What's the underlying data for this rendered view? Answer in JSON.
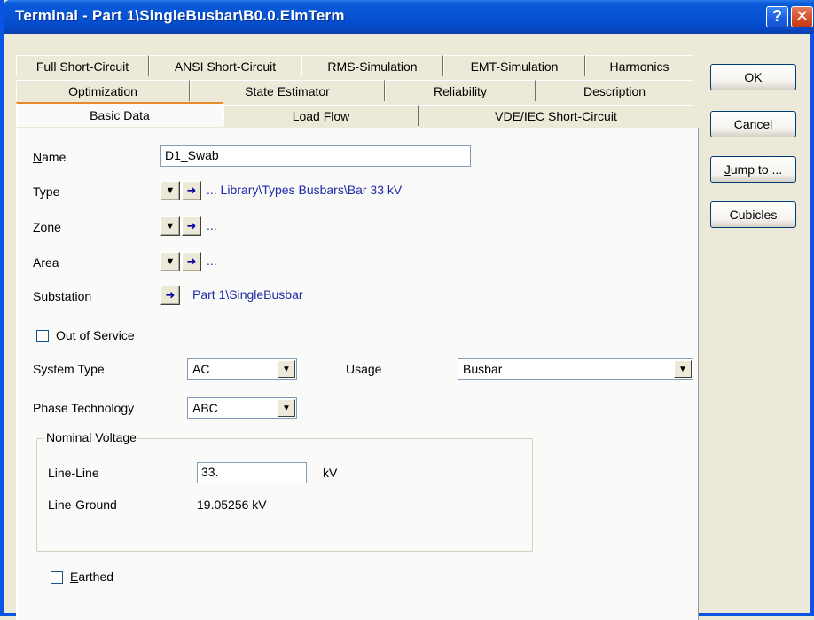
{
  "window": {
    "title": "Terminal - Part 1\\SingleBusbar\\B0.0.ElmTerm"
  },
  "titlebar": {
    "help_glyph": "?",
    "close_glyph": "✕"
  },
  "tabs": {
    "row1": [
      "Full Short-Circuit",
      "ANSI Short-Circuit",
      "RMS-Simulation",
      "EMT-Simulation",
      "Harmonics"
    ],
    "row2": [
      "Optimization",
      "State Estimator",
      "Reliability",
      "Description"
    ],
    "row3": [
      "Basic Data",
      "Load Flow",
      "VDE/IEC Short-Circuit"
    ],
    "active": "Basic Data"
  },
  "form": {
    "name_label_first": "N",
    "name_label_rest": "ame",
    "name_value": "D1_Swab",
    "type_label": "Type",
    "type_link": "... Library\\Types Busbars\\Bar 33 kV",
    "zone_label": "Zone",
    "zone_link": "...",
    "area_label": "Area",
    "area_link": "...",
    "substation_label": "Substation",
    "substation_link": "Part 1\\SingleBusbar",
    "out_of_service_first": "O",
    "out_of_service_rest": "ut of Service",
    "out_of_service_checked": false,
    "system_type_label": "System Type",
    "system_type_value": "AC",
    "usage_label": "Usage",
    "usage_value": "Busbar",
    "phase_tech_label": "Phase Technology",
    "phase_tech_value": "ABC",
    "nominal_voltage": {
      "title": "Nominal Voltage",
      "line_line_label": "Line-Line",
      "line_line_value": "33.",
      "line_line_unit": "kV",
      "line_ground_label": "Line-Ground",
      "line_ground_value": "19.05256 kV"
    },
    "earthed_first": "E",
    "earthed_rest": "arthed",
    "earthed_checked": false
  },
  "buttons": {
    "ok": "OK",
    "cancel": "Cancel",
    "jump_first": "J",
    "jump_rest": "ump to ...",
    "cubicles": "Cubicles"
  },
  "icons": {
    "dropdown": "▼",
    "jump_arrow": "➜"
  },
  "colors": {
    "title_bar": "#0653d4",
    "link": "#1f2aa8",
    "active_tab_accent": "#e68b2c"
  }
}
